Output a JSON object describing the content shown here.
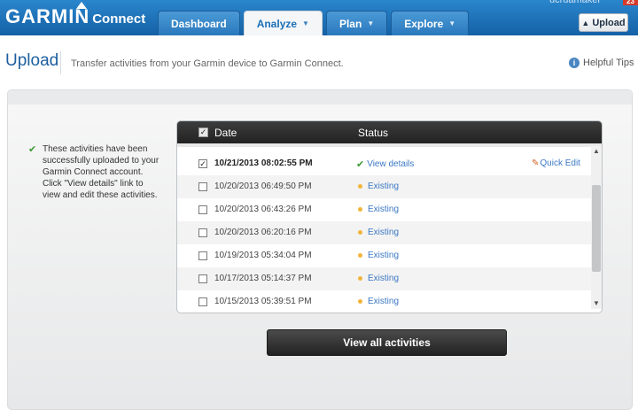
{
  "header": {
    "logo_text": "GARMIN",
    "logo_sub": "Connect",
    "nav": [
      {
        "label": "Dashboard"
      },
      {
        "label": "Analyze"
      },
      {
        "label": "Plan"
      },
      {
        "label": "Explore"
      }
    ],
    "username": "ucruamaker",
    "badge": "23",
    "upload_label": "Upload"
  },
  "page": {
    "title": "Upload",
    "subtitle": "Transfer activities from your Garmin device to Garmin Connect.",
    "helpful_tips": "Helpful Tips"
  },
  "message": "These activities have been successfully uploaded to your Garmin Connect account. Click \"View details\" link to view and edit these activities.",
  "table": {
    "col_date": "Date",
    "col_status": "Status",
    "rows": [
      {
        "date": "10/21/2013 08:02:55 PM",
        "status": "View details",
        "action": "Quick Edit",
        "checked": true
      },
      {
        "date": "10/20/2013 06:49:50 PM",
        "status": "Existing"
      },
      {
        "date": "10/20/2013 06:43:26 PM",
        "status": "Existing"
      },
      {
        "date": "10/20/2013 06:20:16 PM",
        "status": "Existing"
      },
      {
        "date": "10/19/2013 05:34:04 PM",
        "status": "Existing"
      },
      {
        "date": "10/17/2013 05:14:37 PM",
        "status": "Existing"
      },
      {
        "date": "10/15/2013 05:39:51 PM",
        "status": "Existing"
      }
    ]
  },
  "view_all_label": "View all activities"
}
